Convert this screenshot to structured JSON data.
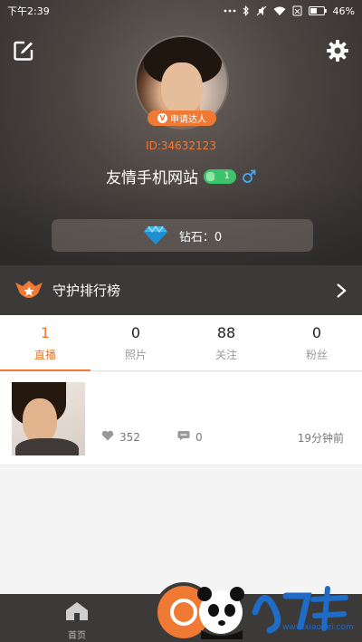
{
  "status_bar": {
    "time": "下午2:39",
    "battery": "46%"
  },
  "profile": {
    "apply_badge": "申请达人",
    "id_text": "ID:34632123",
    "nickname": "友情手机网站",
    "level": "1",
    "diamond_label": "钻石：0"
  },
  "ranking": {
    "title": "守护排行榜"
  },
  "tabs": [
    {
      "count": "1",
      "label": "直播",
      "active": true
    },
    {
      "count": "0",
      "label": "照片",
      "active": false
    },
    {
      "count": "88",
      "label": "关注",
      "active": false
    },
    {
      "count": "0",
      "label": "粉丝",
      "active": false
    }
  ],
  "posts": [
    {
      "likes": "352",
      "comments": "0",
      "time": "19分钟前"
    }
  ],
  "bottom_nav": {
    "home_label": "首页"
  },
  "watermark": {
    "sub": "www.xiaohei.com"
  },
  "colors": {
    "accent": "#f07a33",
    "level_green": "#3cc36b",
    "dark_bar": "#3c3a39"
  }
}
